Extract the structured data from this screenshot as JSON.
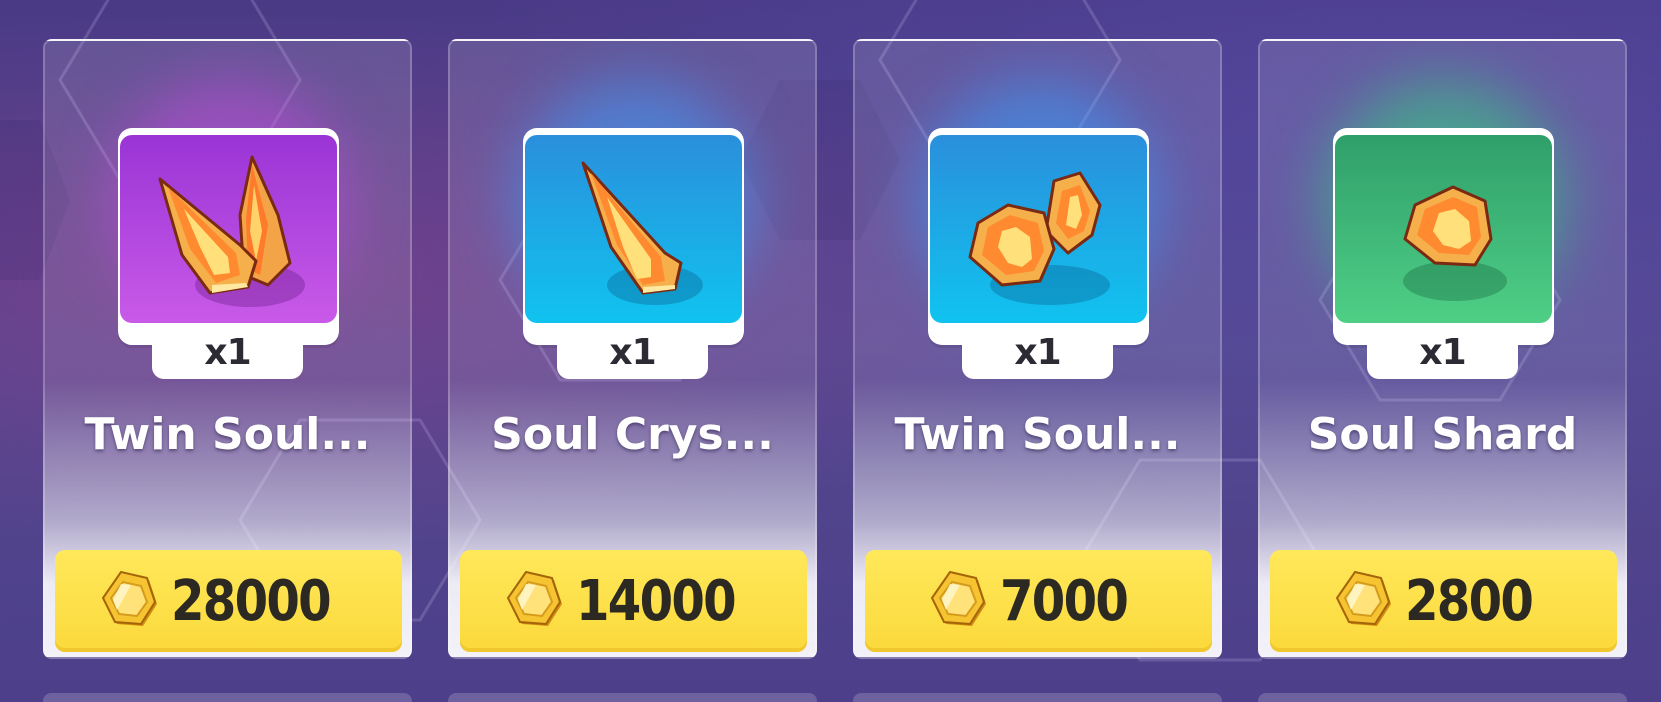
{
  "shop": {
    "items": [
      {
        "name": "Twin Soul...",
        "quantity": "x1",
        "price": "28000",
        "rarity_color": "#b650dd",
        "glow_color": "#c04ce0",
        "icon": "twin-crystal-icon"
      },
      {
        "name": "Soul Crys...",
        "quantity": "x1",
        "price": "14000",
        "rarity_color": "#19b6ea",
        "glow_color": "#3aa0ff",
        "icon": "crystal-icon"
      },
      {
        "name": "Twin Soul...",
        "quantity": "x1",
        "price": "7000",
        "rarity_color": "#19b6ea",
        "glow_color": "#3aa0ff",
        "icon": "twin-shard-icon"
      },
      {
        "name": "Soul Shard",
        "quantity": "x1",
        "price": "2800",
        "rarity_color": "#3dbb7a",
        "glow_color": "#33d67e",
        "icon": "shard-icon"
      }
    ],
    "currency_icon": "gold-coin-icon",
    "price_button_color": "#fcdc44"
  }
}
